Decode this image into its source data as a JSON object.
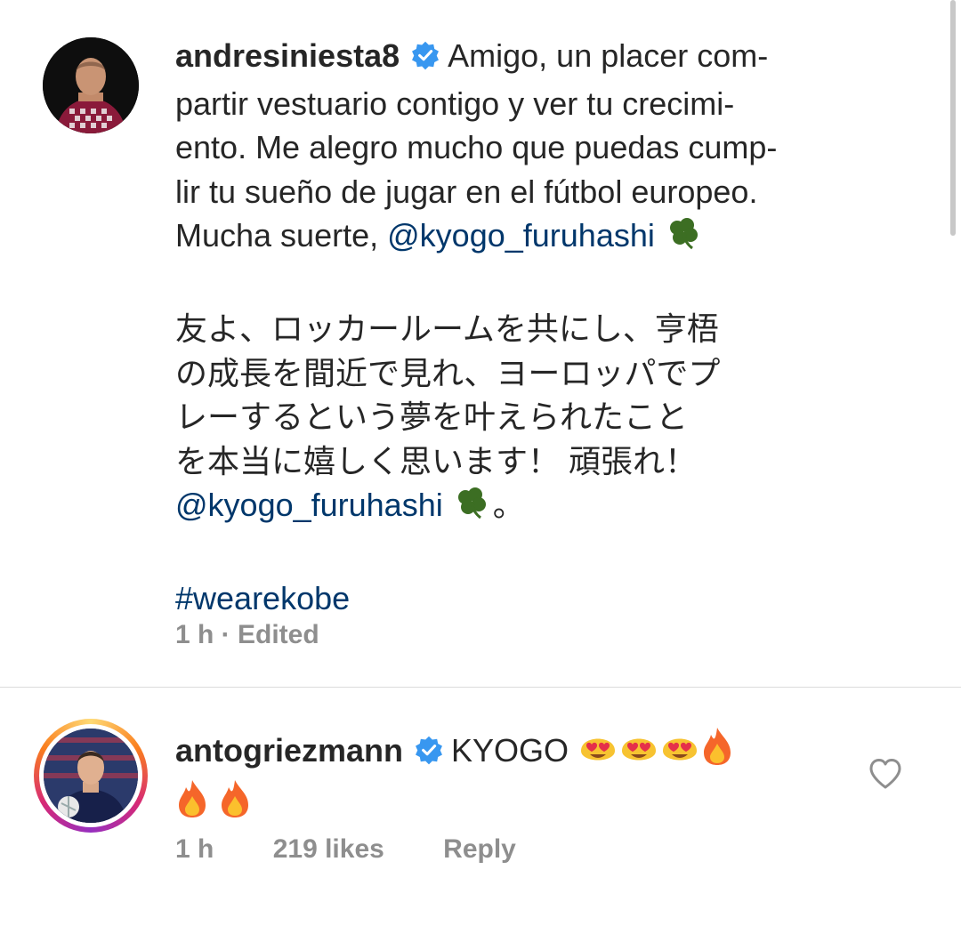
{
  "comments": [
    {
      "username": "andresiniesta8",
      "verified": true,
      "text_lines": [
        "Amigo, un placer com-",
        "partir vestuario contigo y ver tu crecimi-",
        "ento. Me alegro mucho que puedas cump-",
        "lir tu sueño de jugar en el fútbol europeo.",
        "Mucha suerte,"
      ],
      "mention_1": "@kyogo_furuhashi",
      "jp_lines": [
        "友よ、ロッカールームを共にし、亨梧",
        "の成長を間近で見れ、ヨーロッパでプ",
        "レーするという夢を叶えられたこと",
        "を本当に嬉しく思います！ 頑張れ！"
      ],
      "mention_2": "@kyogo_furuhashi",
      "jp_end": "。",
      "hashtag": "#wearekobe",
      "meta": "1 h · Edited"
    },
    {
      "username": "antogriezmann",
      "verified": true,
      "text": "KYOGO",
      "time": "1 h",
      "likes": "219 likes",
      "reply": "Reply"
    }
  ],
  "colors": {
    "text": "#262626",
    "link": "#00376b",
    "meta": "#8e8e8e",
    "verified": "#3897f0",
    "divider": "#dbdbdb"
  },
  "icons": [
    "verified-badge-icon",
    "four-leaf-clover-icon",
    "heart-eyes-emoji",
    "fire-emoji",
    "heart-outline-icon"
  ]
}
